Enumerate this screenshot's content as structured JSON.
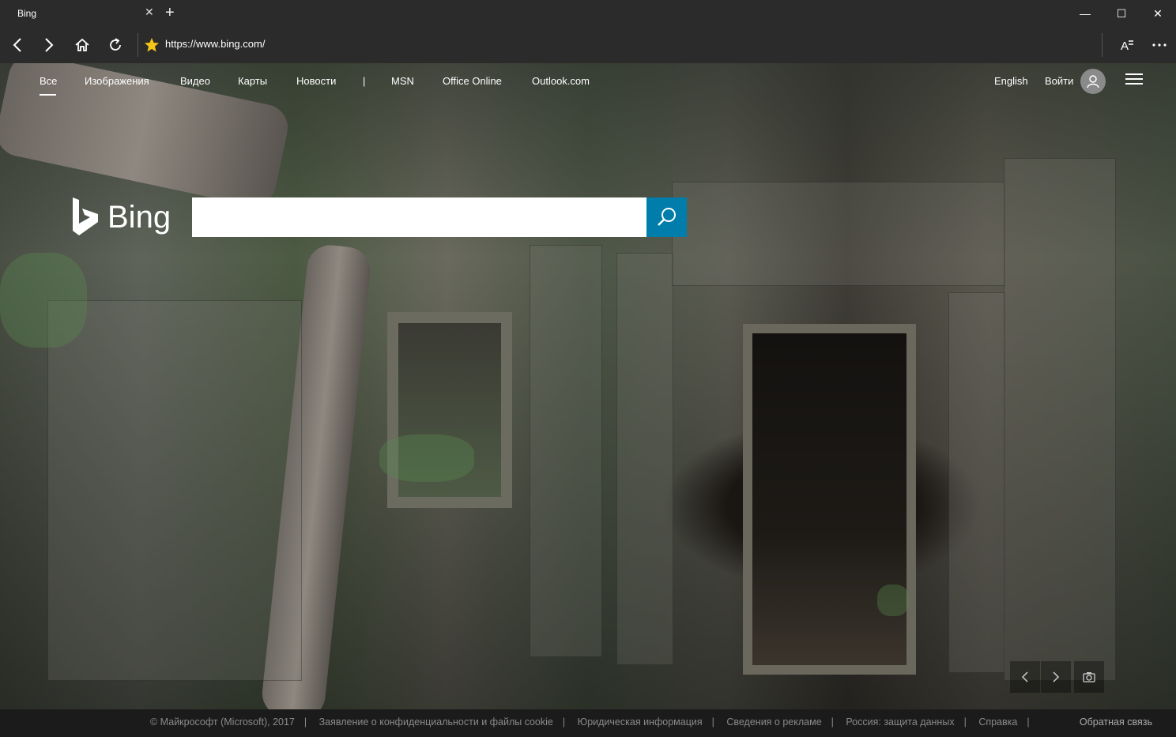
{
  "browser": {
    "tab_title": "Bing",
    "tab_close": "✕",
    "new_tab": "+",
    "url": "https://www.bing.com/",
    "controls": {
      "minimize": "—",
      "maximize": "☐",
      "close": "✕"
    }
  },
  "bing_nav": {
    "left_items": [
      "Все",
      "Изображения",
      "Видео",
      "Карты",
      "Новости"
    ],
    "divider": "|",
    "right_links": [
      "MSN",
      "Office Online",
      "Outlook.com"
    ],
    "language": "English",
    "sign_in": "Войти"
  },
  "logo": {
    "text": "Bing"
  },
  "search": {
    "value": "",
    "placeholder": ""
  },
  "footer": {
    "links": [
      "© Майкрософт (Microsoft), 2017",
      "Заявление о конфиденциальности и файлы cookie",
      "Юридическая информация",
      "Сведения о рекламе",
      "Россия: защита данных",
      "Справка"
    ],
    "feedback": "Обратная связь"
  },
  "colors": {
    "accent": "#007daa",
    "chrome": "#2b2b2b",
    "star": "#f5c518"
  }
}
